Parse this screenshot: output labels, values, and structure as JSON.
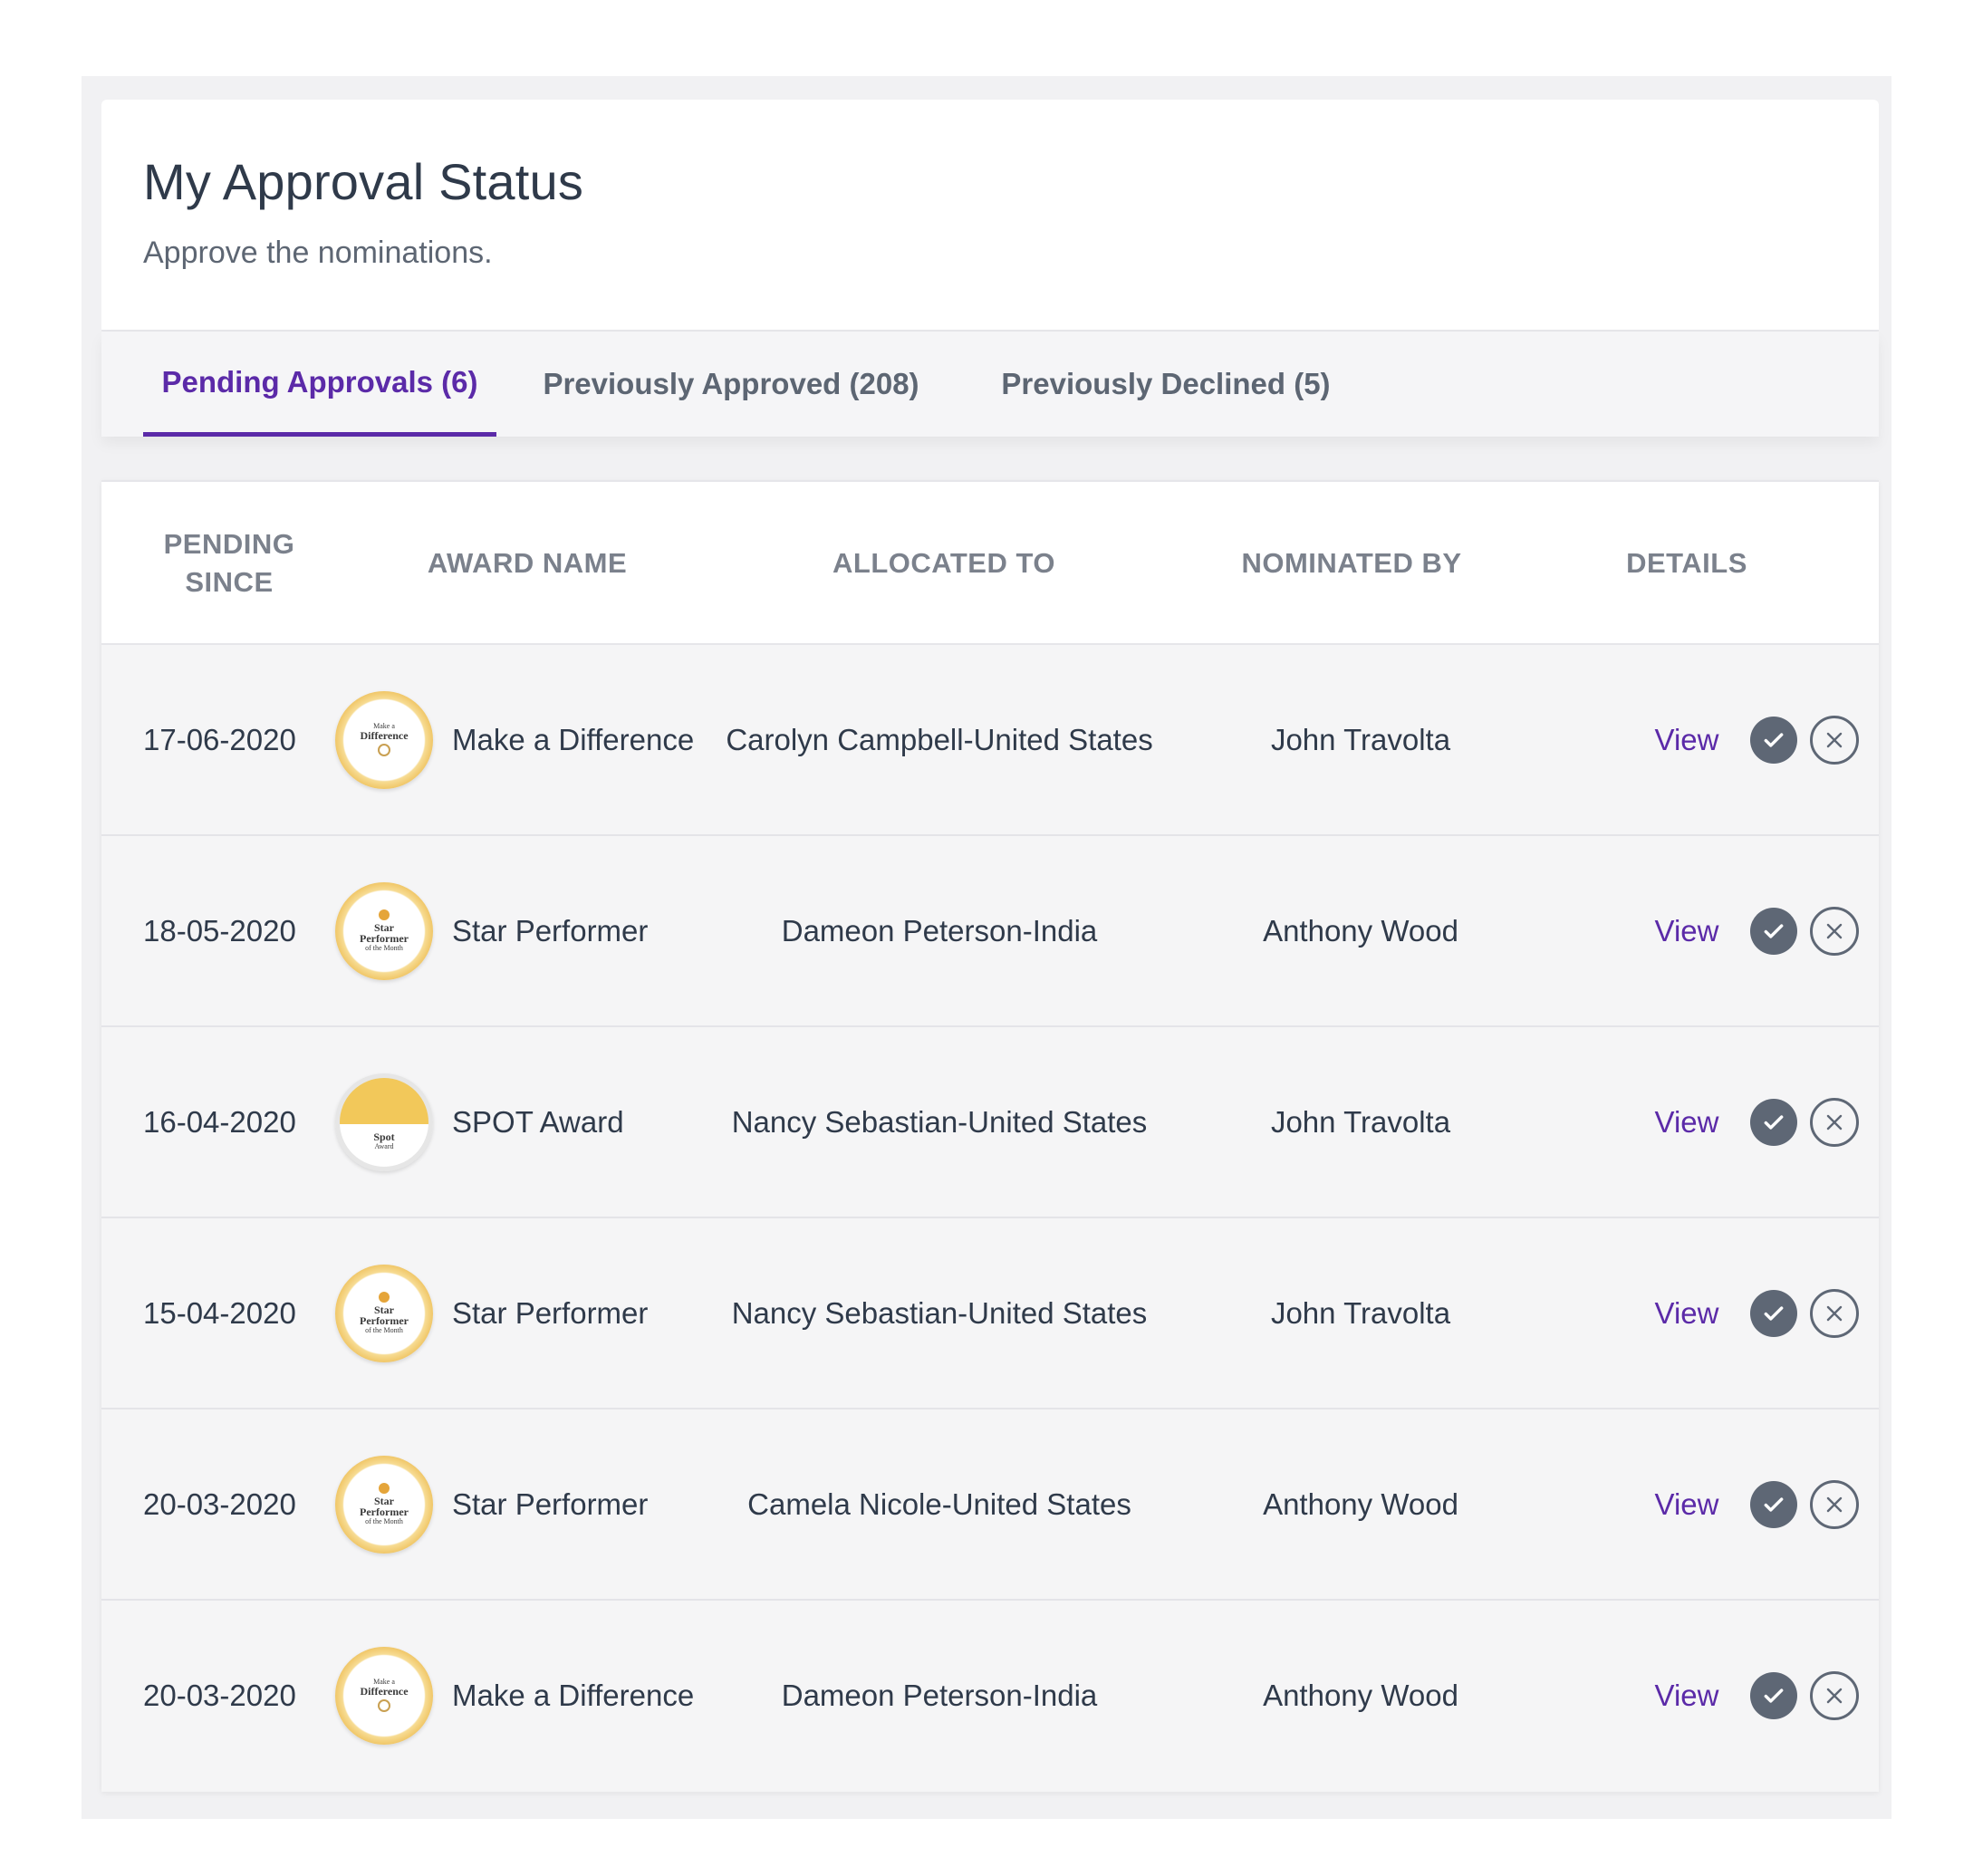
{
  "header": {
    "title": "My Approval Status",
    "subtitle": "Approve the nominations."
  },
  "tabs": [
    {
      "label": "Pending Approvals (6)",
      "active": true
    },
    {
      "label": "Previously Approved (208)",
      "active": false
    },
    {
      "label": "Previously Declined (5)",
      "active": false
    }
  ],
  "table": {
    "columns": {
      "pending_since_line1": "PENDING",
      "pending_since_line2": "SINCE",
      "award_name": "AWARD NAME",
      "allocated_to": "ALLOCATED TO",
      "nominated_by": "NOMINATED BY",
      "details": "DETAILS"
    },
    "badges": {
      "make_difference": {
        "line1": "Make a",
        "line2": "Difference"
      },
      "star_performer": {
        "line1": "Star",
        "line2": "Performer",
        "line3": "of the Month"
      },
      "spot_award": {
        "line1": "Spot",
        "line2": "Award"
      }
    },
    "rows": [
      {
        "date": "17-06-2020",
        "award": "Make a Difference",
        "badge": "make_difference",
        "allocated": "Carolyn Campbell-United States",
        "nominated": "John Travolta",
        "details": "View"
      },
      {
        "date": "18-05-2020",
        "award": "Star Performer",
        "badge": "star_performer",
        "allocated": "Dameon Peterson-India",
        "nominated": "Anthony Wood",
        "details": "View"
      },
      {
        "date": "16-04-2020",
        "award": "SPOT Award",
        "badge": "spot_award",
        "allocated": "Nancy Sebastian-United States",
        "nominated": "John Travolta",
        "details": "View"
      },
      {
        "date": "15-04-2020",
        "award": "Star Performer",
        "badge": "star_performer",
        "allocated": "Nancy Sebastian-United States",
        "nominated": "John Travolta",
        "details": "View"
      },
      {
        "date": "20-03-2020",
        "award": "Star Performer",
        "badge": "star_performer",
        "allocated": "Camela Nicole-United States",
        "nominated": "Anthony Wood",
        "details": "View"
      },
      {
        "date": "20-03-2020",
        "award": "Make a Difference",
        "badge": "make_difference",
        "allocated": "Dameon Peterson-India",
        "nominated": "Anthony Wood",
        "details": "View"
      }
    ]
  },
  "icons": {
    "approve": "check-circle-icon",
    "decline": "x-circle-icon"
  },
  "colors": {
    "accent": "#5b2aa8",
    "text": "#2f3a4a",
    "muted": "#7b818c",
    "action": "#5e6775"
  }
}
